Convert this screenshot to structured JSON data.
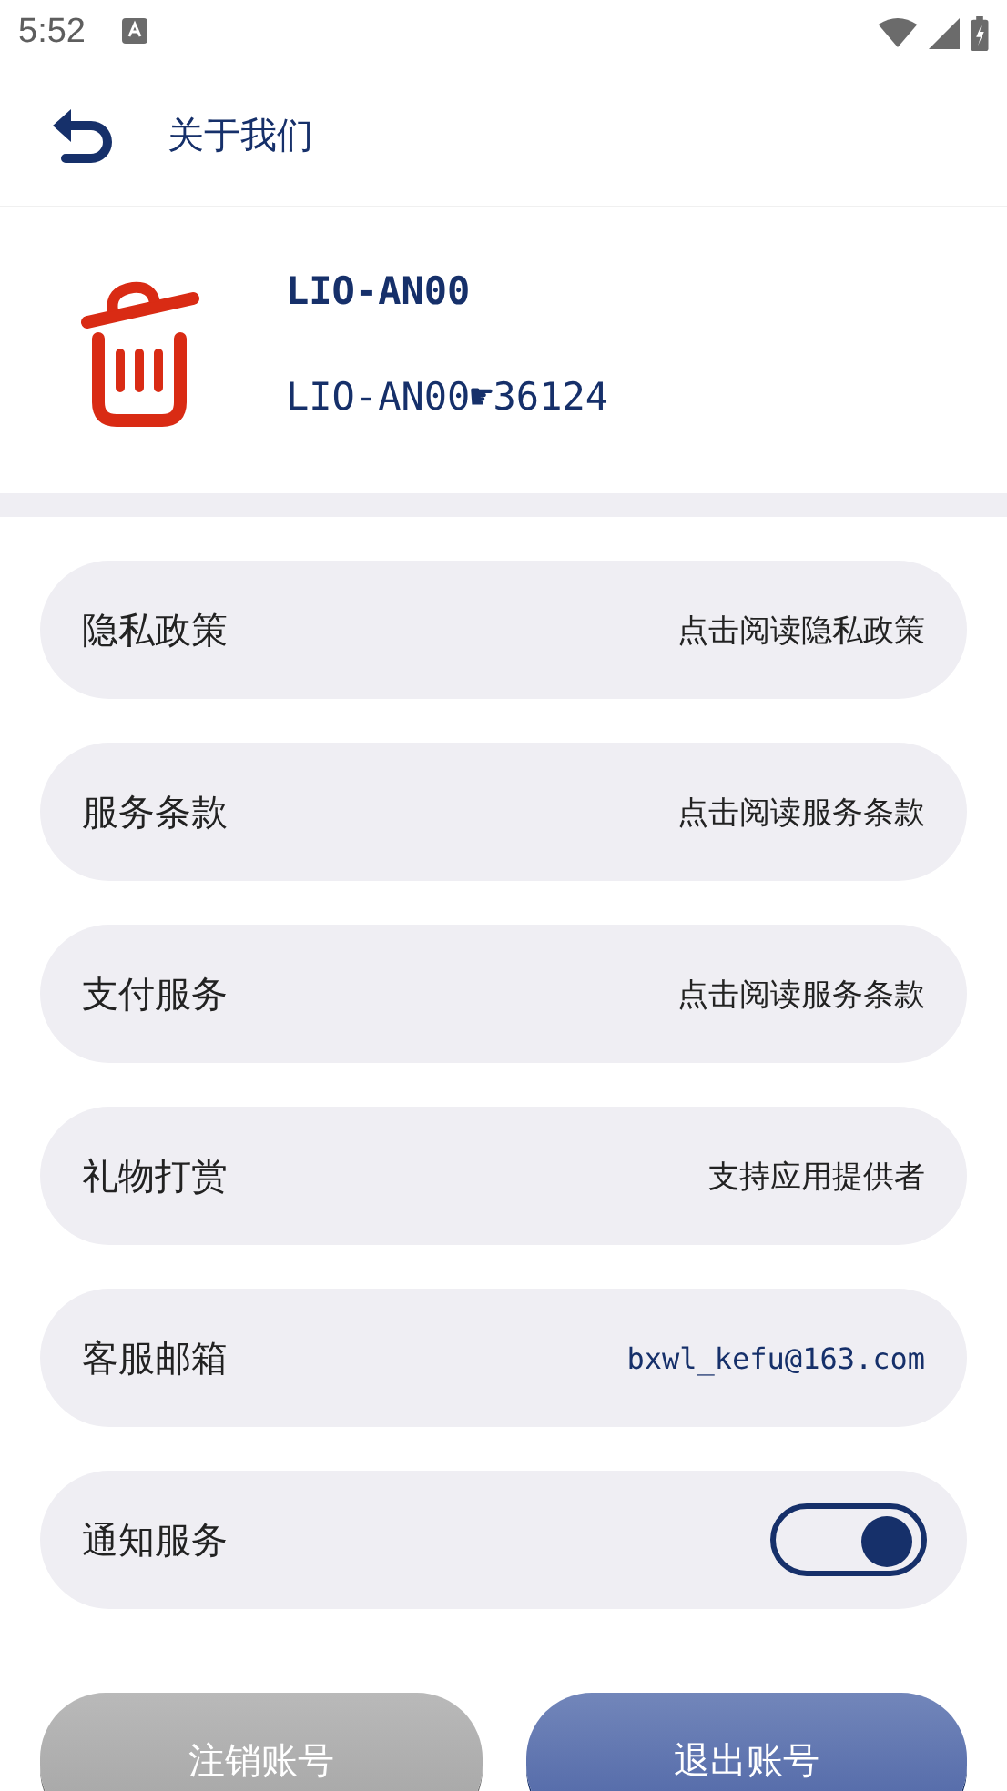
{
  "status_bar": {
    "time": "5:52"
  },
  "header": {
    "title": "关于我们"
  },
  "app_info": {
    "name": "LIO-AN00",
    "version": "LIO-AN00☛36124"
  },
  "rows": [
    {
      "kind": "link",
      "label": "隐私政策",
      "value": "点击阅读隐私政策"
    },
    {
      "kind": "link",
      "label": "服务条款",
      "value": "点击阅读服务条款"
    },
    {
      "kind": "link",
      "label": "支付服务",
      "value": "点击阅读服务条款"
    },
    {
      "kind": "link",
      "label": "礼物打赏",
      "value": "支持应用提供者"
    },
    {
      "kind": "email",
      "label": "客服邮箱",
      "value": "bxwl_kefu@163.com"
    },
    {
      "kind": "toggle",
      "label": "通知服务",
      "on": true
    }
  ],
  "buttons": [
    {
      "label": "注销账号",
      "kind": "secondary"
    },
    {
      "label": "退出账号",
      "kind": "primary"
    }
  ]
}
